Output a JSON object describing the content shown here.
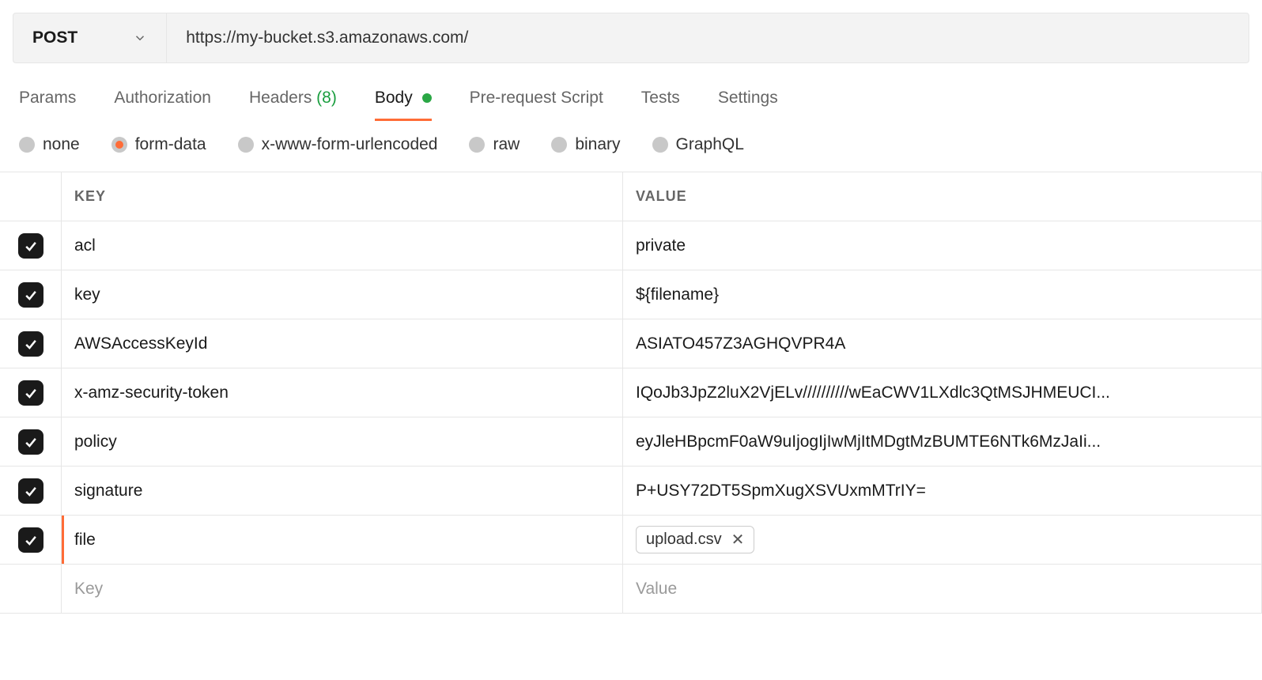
{
  "request": {
    "method": "POST",
    "url": "https://my-bucket.s3.amazonaws.com/"
  },
  "tabs": {
    "params_label": "Params",
    "authorization_label": "Authorization",
    "headers_label": "Headers",
    "headers_count": "(8)",
    "body_label": "Body",
    "pre_request_label": "Pre-request Script",
    "tests_label": "Tests",
    "settings_label": "Settings",
    "active": "body"
  },
  "body_types": {
    "none": "none",
    "form_data": "form-data",
    "x_www": "x-www-form-urlencoded",
    "raw": "raw",
    "binary": "binary",
    "graphql": "GraphQL",
    "selected": "form-data"
  },
  "kv": {
    "header_key": "KEY",
    "header_value": "VALUE",
    "rows": [
      {
        "enabled": true,
        "key": "acl",
        "value": "private",
        "type": "text"
      },
      {
        "enabled": true,
        "key": "key",
        "value": "${filename}",
        "type": "text"
      },
      {
        "enabled": true,
        "key": "AWSAccessKeyId",
        "value": "ASIATO457Z3AGHQVPR4A",
        "type": "text"
      },
      {
        "enabled": true,
        "key": "x-amz-security-token",
        "value": "IQoJb3JpZ2luX2VjELv//////////wEaCWV1LXdlc3QtMSJHMEUCI...",
        "type": "text"
      },
      {
        "enabled": true,
        "key": "policy",
        "value": "eyJleHBpcmF0aW9uIjogIjIwMjItMDgtMzBUMTE6NTk6MzJaIi...",
        "type": "text"
      },
      {
        "enabled": true,
        "key": "signature",
        "value": "P+USY72DT5SpmXugXSVUxmMTrIY=",
        "type": "text"
      },
      {
        "enabled": true,
        "key": "file",
        "value": "upload.csv",
        "type": "file"
      }
    ],
    "placeholder_key": "Key",
    "placeholder_value": "Value"
  }
}
